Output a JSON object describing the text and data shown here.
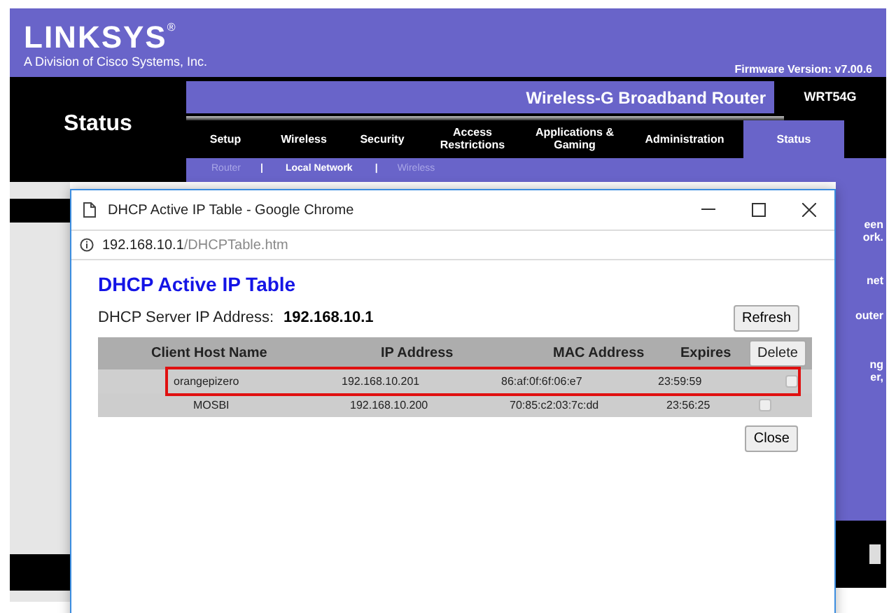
{
  "brand": {
    "logo": "LINKSYS",
    "registered": "®",
    "tagline": "A Division of Cisco Systems, Inc.",
    "firmware": "Firmware Version: v7.00.6"
  },
  "product": {
    "name": "Wireless-G Broadband Router",
    "model": "WRT54G"
  },
  "section_title": "Status",
  "tabs": [
    {
      "label": "Setup",
      "selected": false
    },
    {
      "label": "Wireless",
      "selected": false
    },
    {
      "label": "Security",
      "selected": false
    },
    {
      "label": "Access Restrictions",
      "selected": false
    },
    {
      "label": "Applications & Gaming",
      "selected": false
    },
    {
      "label": "Administration",
      "selected": false
    },
    {
      "label": "Status",
      "selected": true
    }
  ],
  "subtabs": [
    {
      "label": "Router",
      "selected": false
    },
    {
      "label": "Local Network",
      "selected": true
    },
    {
      "label": "Wireless",
      "selected": false
    }
  ],
  "subtab_separator": "|",
  "side_fragments": [
    "een",
    "ork.",
    "net",
    "outer",
    "ng",
    "er,"
  ],
  "popup": {
    "title": "DHCP Active IP Table - Google Chrome",
    "url_host": "192.168.10.1",
    "url_path": "/DHCPTable.htm",
    "heading": "DHCP Active IP Table",
    "server_label": "DHCP Server IP Address:",
    "server_ip": "192.168.10.1",
    "refresh": "Refresh",
    "delete": "Delete",
    "close": "Close",
    "columns": [
      "Client Host Name",
      "IP Address",
      "MAC Address",
      "Expires"
    ],
    "rows": [
      {
        "host": "orangepizero",
        "ip": "192.168.10.201",
        "mac": "86:af:0f:6f:06:e7",
        "expires": "23:59:59",
        "checked": false,
        "highlighted": true
      },
      {
        "host": "MOSBI",
        "ip": "192.168.10.200",
        "mac": "70:85:c2:03:7c:dd",
        "expires": "23:56:25",
        "checked": false,
        "highlighted": false
      }
    ]
  }
}
